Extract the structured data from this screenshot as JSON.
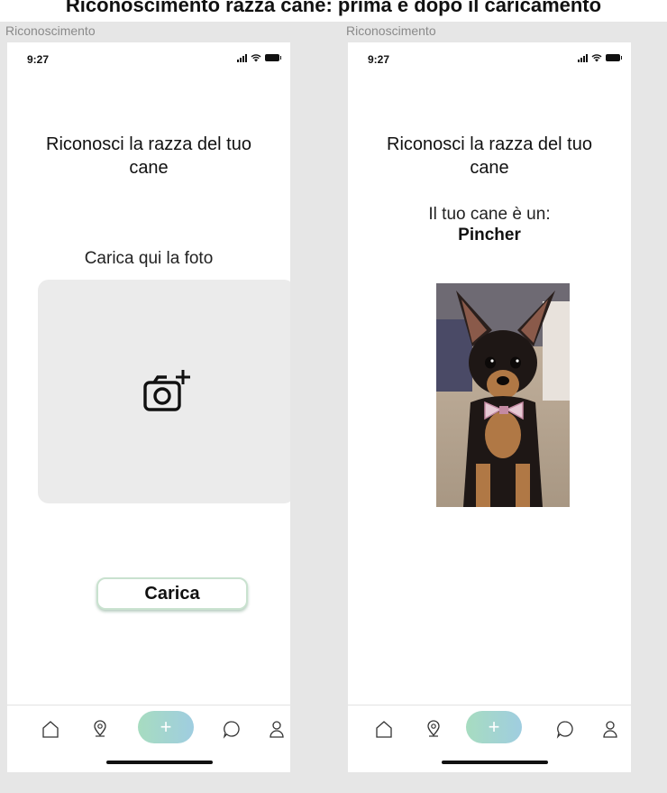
{
  "banner": {
    "title": "Riconoscimento razza cane: prima e dopo il caricamento"
  },
  "screens": [
    {
      "frame_label": "Riconoscimento",
      "status_time": "9:27",
      "title": "Riconosci la razza del tuo cane",
      "upload_label": "Carica qui la foto",
      "upload_button": "Carica"
    },
    {
      "frame_label": "Riconoscimento",
      "status_time": "9:27",
      "title": "Riconosci la razza del tuo cane",
      "result_label": "Il tuo cane è un:",
      "result_breed": "Pincher"
    }
  ],
  "tabbar": {
    "icons": [
      "home-icon",
      "map-pin-icon",
      "plus-icon",
      "chat-icon",
      "profile-icon"
    ],
    "add_label": "+"
  },
  "colors": {
    "background": "#e6e6e6",
    "upload_box": "#ebebeb",
    "button_border": "#c9e2cf",
    "add_gradient_start": "#a7dcc0",
    "add_gradient_end": "#9fcde0"
  }
}
